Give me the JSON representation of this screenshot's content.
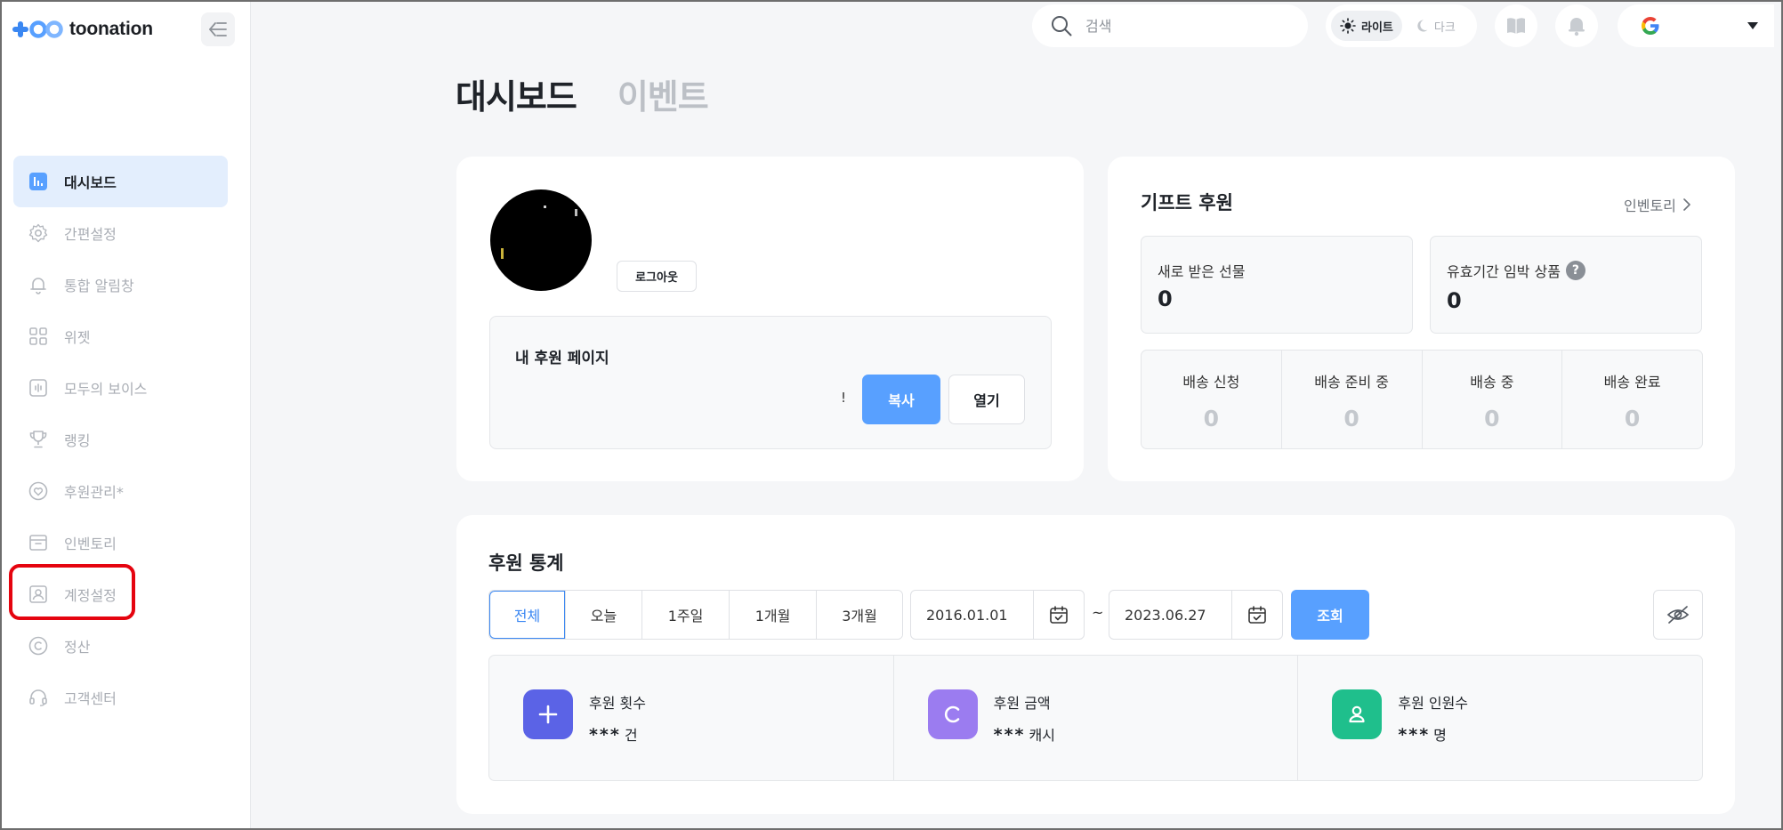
{
  "brand": {
    "name": "toonation"
  },
  "sidebar": {
    "items": [
      {
        "label": "대시보드",
        "icon": "bar-chart-icon",
        "active": true
      },
      {
        "label": "간편설정",
        "icon": "gear-icon"
      },
      {
        "label": "통합 알림창",
        "icon": "bell-icon"
      },
      {
        "label": "위젯",
        "icon": "grid-icon"
      },
      {
        "label": "모두의 보이스",
        "icon": "voice-icon"
      },
      {
        "label": "랭킹",
        "icon": "trophy-icon"
      },
      {
        "label": "후원관리*",
        "icon": "heart-icon"
      },
      {
        "label": "인벤토리",
        "icon": "inventory-icon"
      },
      {
        "label": "계정설정",
        "icon": "account-icon"
      },
      {
        "label": "정산",
        "icon": "copyright-icon"
      },
      {
        "label": "고객센터",
        "icon": "headset-icon"
      }
    ]
  },
  "topbar": {
    "search_placeholder": "검색",
    "theme_light": "라이트",
    "theme_dark": "다크",
    "active_theme": "light"
  },
  "page": {
    "tabs": [
      {
        "label": "대시보드",
        "active": true
      },
      {
        "label": "이벤트",
        "active": false
      }
    ]
  },
  "profile": {
    "logout_label": "로그아웃",
    "donate_page_title": "내 후원 페이지",
    "url_tail": "!",
    "copy_label": "복사",
    "open_label": "열기"
  },
  "gift": {
    "title": "기프트 후원",
    "inventory_link": "인벤토리",
    "new_gifts_label": "새로 받은 선물",
    "new_gifts_value": "0",
    "expiring_label": "유효기간 임박 상품",
    "expiring_value": "0",
    "help_badge": "?",
    "shipping": [
      {
        "label": "배송 신청",
        "value": "0"
      },
      {
        "label": "배송 준비 중",
        "value": "0"
      },
      {
        "label": "배송 중",
        "value": "0"
      },
      {
        "label": "배송 완료",
        "value": "0"
      }
    ]
  },
  "stats": {
    "title": "후원 통계",
    "periods": [
      "전체",
      "오늘",
      "1주일",
      "1개월",
      "3개월"
    ],
    "selected_period": "전체",
    "start_date": "2016.01.01",
    "end_date": "2023.06.27",
    "range_separator": "~",
    "query_label": "조회",
    "metrics": [
      {
        "label": "후원 횟수",
        "masked": "***",
        "unit": "건",
        "icon": "plus-icon",
        "color": "#5b63e6"
      },
      {
        "label": "후원 금액",
        "masked": "***",
        "unit": "캐시",
        "icon": "cash-icon",
        "color": "#9b7cf0"
      },
      {
        "label": "후원 인원수",
        "masked": "***",
        "unit": "명",
        "icon": "person-icon",
        "color": "#1fbf8c"
      }
    ]
  },
  "colors": {
    "primary": "#58a0ff",
    "active_nav_bg": "#e3eefd",
    "highlight": "#e5040f"
  }
}
